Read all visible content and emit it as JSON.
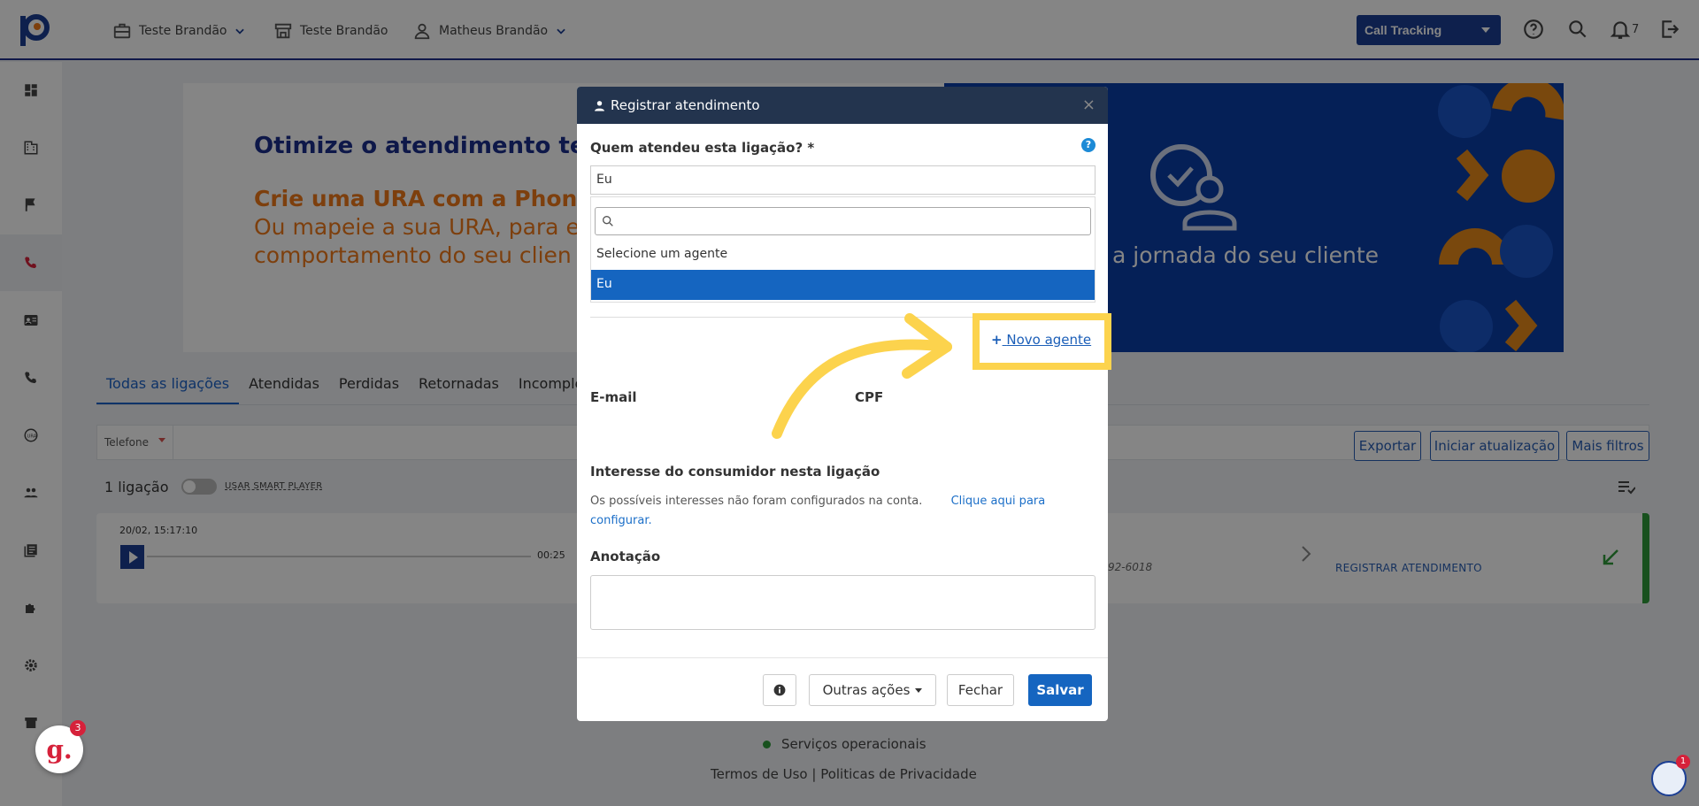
{
  "header": {
    "account1": "Teste Brandão",
    "account2": "Teste Brandão",
    "user": "Matheus Brandão",
    "product_select": "Call Tracking",
    "notification_count": "7"
  },
  "banner": {
    "title": "Otimize o atendimento telef",
    "subtitle_bold": "Crie uma URA com a PhoneT",
    "subtitle_line2": "Ou mapeie a sua URA, para e",
    "subtitle_line3": "comportamento do seu clien",
    "right_text": "a jornada do seu cliente"
  },
  "tabs": [
    "Todas as ligações",
    "Atendidas",
    "Perdidas",
    "Retornadas",
    "Incomple"
  ],
  "filters": {
    "phone_filter": "Telefone",
    "export_button": "Exportar",
    "refresh_button": "Iniciar atualização",
    "more_filters_button": "Mais filtros"
  },
  "calls": {
    "count_text": "1 ligação",
    "smart_player_label": "USAR SMART PLAYER",
    "date": "20/02, 15:17:10",
    "duration": "00:25",
    "phone_partial": "92-6018",
    "register_link": "REGISTRAR ATENDIMENTO"
  },
  "modal": {
    "title": "Registrar atendimento",
    "question_label": "Quem atendeu esta ligação? *",
    "selected_value": "Eu",
    "options": [
      "Selecione um agente",
      "Eu"
    ],
    "new_agent_link": "Novo agente",
    "email_label": "E-mail",
    "cpf_label": "CPF",
    "interest_title": "Interesse do consumidor nesta ligação",
    "interest_note": "Os possíveis interesses não foram configurados na conta.",
    "interest_link": "Clique aqui para configurar.",
    "annotation_label": "Anotação",
    "other_actions_button": "Outras ações",
    "close_button": "Fechar",
    "save_button": "Salvar"
  },
  "footer": {
    "status": "Serviços operacionais",
    "links": "Termos de Uso | Politicas de Privacidade"
  },
  "widgets": {
    "g_count": "3",
    "help_count": "1"
  },
  "colors": {
    "brand_blue": "#1c3f94",
    "primary": "#1565c0",
    "highlight": "#fcd34d",
    "accent_orange": "#f07a1a",
    "success": "#2e9b3a"
  }
}
